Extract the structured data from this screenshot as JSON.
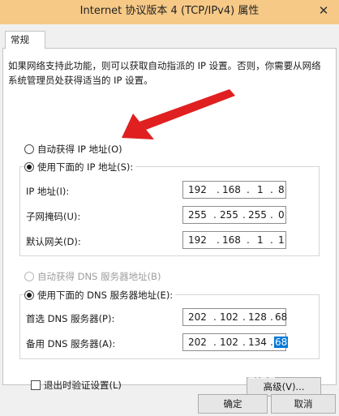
{
  "window": {
    "title": "Internet 协议版本 4 (TCP/IPv4) 属性",
    "close_glyph": "✕"
  },
  "tab": {
    "label": "常规"
  },
  "intro_text": "如果网络支持此功能，则可以获取自动指派的 IP 设置。否则，你需要从网络系统管理员处获得适当的 IP 设置。",
  "ip_mode": {
    "auto_label": "自动获得 IP 地址(O)",
    "manual_label": "使用下面的 IP 地址(S):",
    "selected": "manual"
  },
  "ip_fields": [
    {
      "label": "IP 地址(I):",
      "octets": [
        "192",
        "168",
        "1",
        "8"
      ]
    },
    {
      "label": "子网掩码(U):",
      "octets": [
        "255",
        "255",
        "255",
        "0"
      ]
    },
    {
      "label": "默认网关(D):",
      "octets": [
        "192",
        "168",
        "1",
        "1"
      ]
    }
  ],
  "dns_mode": {
    "auto_label": "自动获得 DNS 服务器地址(B)",
    "manual_label": "使用下面的 DNS 服务器地址(E):",
    "selected": "manual",
    "auto_disabled": true
  },
  "dns_fields": [
    {
      "label": "首选 DNS 服务器(P):",
      "octets": [
        "202",
        "102",
        "128",
        "68"
      ]
    },
    {
      "label": "备用 DNS 服务器(A):",
      "octets": [
        "202",
        "102",
        "134",
        "68"
      ],
      "selected_octet": 3
    }
  ],
  "validate_checkbox": {
    "label": "退出时验证设置(L)",
    "checked": false
  },
  "buttons": {
    "advanced": "高级(V)...",
    "ok": "确定",
    "cancel": "取消"
  },
  "watermark": "Baidu",
  "colors": {
    "title_bar": "#f6c987",
    "annotation_arrow": "#e02020",
    "selection": "#0078d7"
  }
}
